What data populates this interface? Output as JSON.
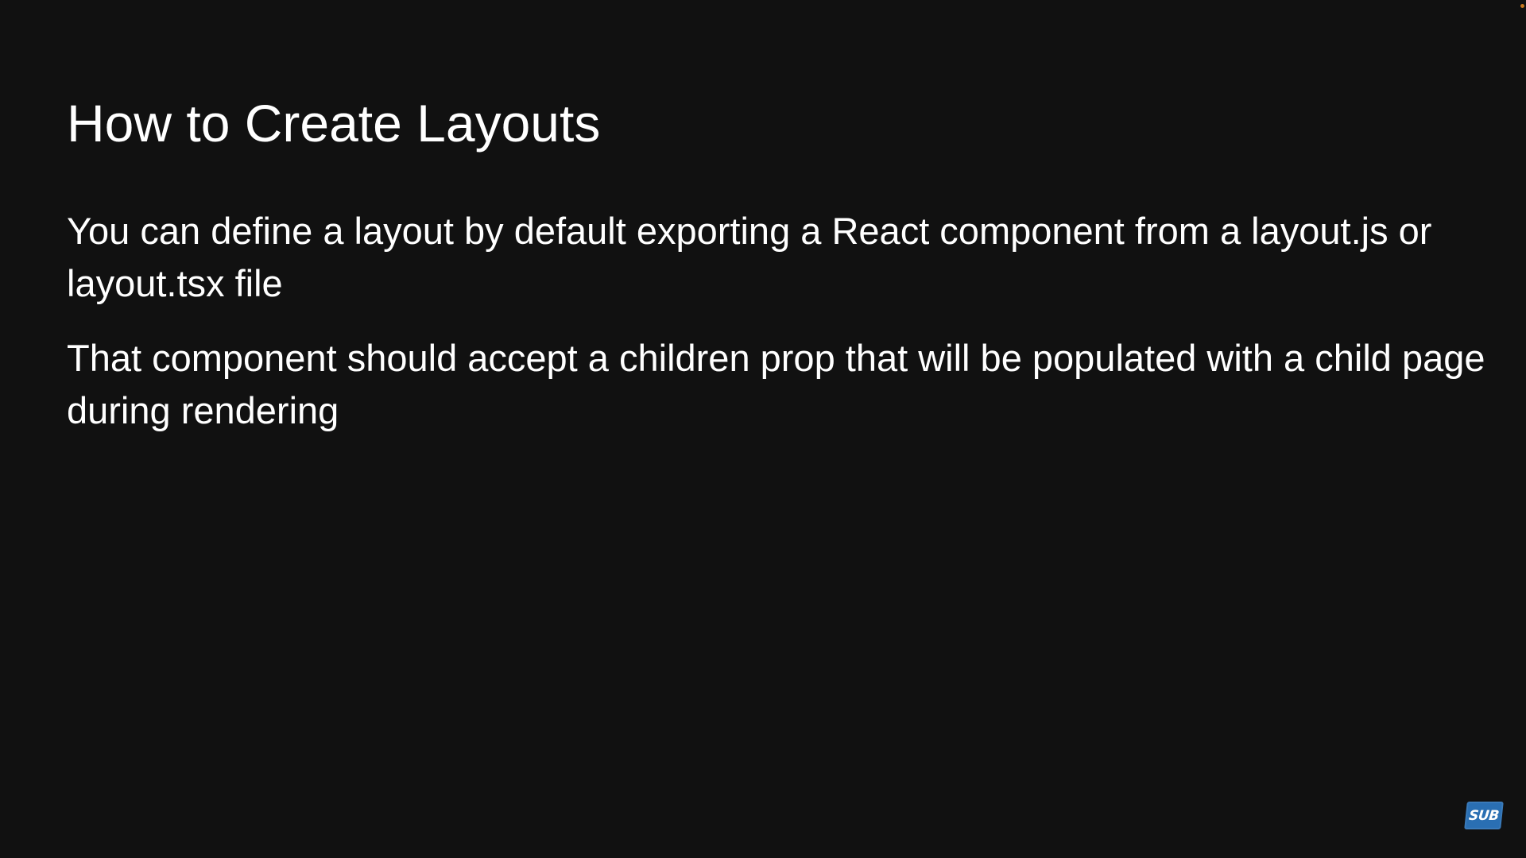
{
  "slide": {
    "title": "How to Create Layouts",
    "paragraphs": [
      "You can define a layout by default exporting a React component from a layout.js or layout.tsx file",
      "That component should accept a children prop that will be populated with a child page during rendering"
    ]
  },
  "overlay": {
    "subscribe_badge": "SUB"
  },
  "colors": {
    "background": "#111111",
    "text": "#ffffff",
    "badge": "#2a6fb3",
    "corner_dot": "#c8781e"
  }
}
